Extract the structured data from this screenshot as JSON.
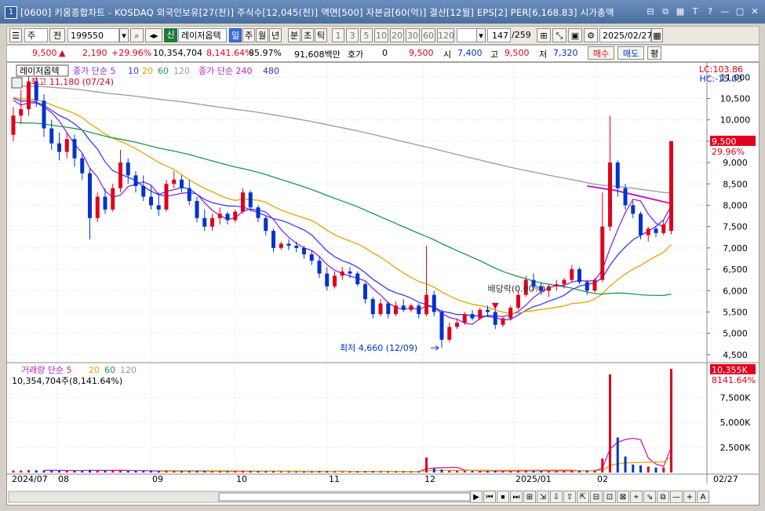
{
  "window": {
    "num": "1",
    "title": "[0600] 키움종합차트 - KOSDAQ 외국인보유[27(천)] 주식수[12,045(천)] 액면[500] 자본금[60(억)] 결산[12월] EPS[2] PER[6,168.83] 시가총액",
    "buttons": [
      "⊟",
      "⧉",
      "▦",
      "T",
      "?",
      "—",
      "□",
      "✕"
    ]
  },
  "toolbar": {
    "period_type": "주",
    "prefix": "전",
    "code": "199550",
    "sin": "신",
    "stock_name": "레이저옵텍",
    "periods": [
      "일",
      "주",
      "월",
      "년",
      "분",
      "초",
      "틱"
    ],
    "active_period": "일",
    "nums": [
      "1",
      "3",
      "5",
      "10",
      "20",
      "30",
      "60",
      "120"
    ],
    "count": "147",
    "total": "/259",
    "date": "2025/02/27"
  },
  "quote": {
    "price": "9,500",
    "arrow": "▲",
    "change": "2,190",
    "change_pct": "+29.96%",
    "volume": "10,354,704",
    "vol_ratio": "8,141.64%",
    "turnover": "85.97%",
    "amount": "91,608백만",
    "hoga_label": "호가",
    "hoga_val": "0",
    "ask": "9,500",
    "open_label": "시",
    "open": "7,400",
    "high_label": "고",
    "high": "9,500",
    "low_label": "저",
    "low": "7,320",
    "buy": "매수",
    "sell": "매도",
    "avg": "평"
  },
  "chart_data": {
    "type": "candlestick",
    "price_panel": {
      "stock": "레이저옵텍",
      "legend": [
        {
          "text": "종가 단순 5",
          "color": "#8a2be2"
        },
        {
          "text": "10",
          "color": "#3a3aff"
        },
        {
          "text": "20",
          "color": "#e6a400"
        },
        {
          "text": "60",
          "color": "#1a9a4a"
        },
        {
          "text": "120",
          "color": "#9a9a9a"
        },
        {
          "text": "종가 단순 240",
          "color": "#c020c0"
        },
        {
          "text": "480",
          "color": "#3030c0"
        }
      ],
      "lc": "LC:103.86",
      "hc": "HC:-15.03",
      "max_annot": "최고 11,180 (07/24)",
      "min_annot": "최저 4,660 (12/09)",
      "div_annot": "배당락(0.00%)",
      "last_price": "9,500",
      "last_pct": "29.96%",
      "y_ticks": [
        "11,000",
        "10,500",
        "10,000",
        "9,500",
        "9,000",
        "8,500",
        "8,000",
        "7,500",
        "7,000",
        "6,500",
        "6,000",
        "5,500",
        "5,000",
        "4,500"
      ],
      "ylim": [
        4350,
        11300
      ]
    },
    "volume_panel": {
      "legend": [
        {
          "text": "거래량 단순 5",
          "color": "#c020c0"
        },
        {
          "text": "20",
          "color": "#e6a400"
        },
        {
          "text": "60",
          "color": "#1a9a4a"
        },
        {
          "text": "120",
          "color": "#9a9a9a"
        }
      ],
      "info": "10,354,704주(8,141.64%)",
      "last_vol": "10,355K",
      "last_pct": "8141.64%",
      "y_ticks": [
        "7,500K",
        "5,000K",
        "2,500K"
      ],
      "ylim": [
        0,
        10500
      ]
    },
    "x_labels": [
      "2024/07",
      "08",
      "09",
      "10",
      "11",
      "12",
      "2025/01",
      "02",
      "02/27"
    ],
    "candles": [
      [
        9650,
        10300,
        9500,
        10100
      ],
      [
        10100,
        10700,
        9900,
        10250
      ],
      [
        10250,
        11180,
        10100,
        10900
      ],
      [
        10900,
        11000,
        10300,
        10450
      ],
      [
        10450,
        10600,
        9600,
        9800
      ],
      [
        9800,
        10000,
        9300,
        9450
      ],
      [
        9450,
        9700,
        9050,
        9250
      ],
      [
        9250,
        9700,
        9100,
        9550
      ],
      [
        9550,
        9650,
        8900,
        9100
      ],
      [
        9100,
        9200,
        8600,
        8750
      ],
      [
        8750,
        8850,
        7200,
        7700
      ],
      [
        7700,
        8300,
        7600,
        8200
      ],
      [
        8200,
        8400,
        7800,
        7900
      ],
      [
        7900,
        8500,
        7850,
        8400
      ],
      [
        8400,
        9300,
        8300,
        9000
      ],
      [
        9000,
        9100,
        8500,
        8700
      ],
      [
        8700,
        8800,
        8300,
        8450
      ],
      [
        8450,
        8700,
        8100,
        8200
      ],
      [
        8200,
        8450,
        7900,
        8000
      ],
      [
        8000,
        8300,
        7750,
        7900
      ],
      [
        7900,
        8600,
        7850,
        8500
      ],
      [
        8500,
        8800,
        8400,
        8600
      ],
      [
        8600,
        8700,
        8300,
        8400
      ],
      [
        8400,
        8600,
        8000,
        8100
      ],
      [
        8100,
        8200,
        7600,
        7700
      ],
      [
        7700,
        7900,
        7400,
        7500
      ],
      [
        7500,
        7800,
        7400,
        7700
      ],
      [
        7700,
        7950,
        7550,
        7800
      ],
      [
        7800,
        7850,
        7550,
        7650
      ],
      [
        7650,
        7900,
        7600,
        7850
      ],
      [
        7850,
        8400,
        7800,
        8300
      ],
      [
        8300,
        8350,
        7850,
        7950
      ],
      [
        7950,
        8000,
        7600,
        7700
      ],
      [
        7700,
        7750,
        7300,
        7400
      ],
      [
        7400,
        7450,
        6900,
        7000
      ],
      [
        7000,
        7150,
        6950,
        7100
      ],
      [
        7100,
        7200,
        6950,
        7050
      ],
      [
        7050,
        7150,
        6900,
        7000
      ],
      [
        7000,
        7050,
        6750,
        6850
      ],
      [
        6850,
        6950,
        6600,
        6700
      ],
      [
        6700,
        6800,
        6300,
        6400
      ],
      [
        6400,
        6550,
        6000,
        6100
      ],
      [
        6100,
        6450,
        6050,
        6350
      ],
      [
        6350,
        6550,
        6250,
        6450
      ],
      [
        6450,
        6550,
        6300,
        6400
      ],
      [
        6400,
        6450,
        6100,
        6150
      ],
      [
        6150,
        6200,
        5700,
        5800
      ],
      [
        5800,
        5850,
        5350,
        5450
      ],
      [
        5450,
        5800,
        5400,
        5700
      ],
      [
        5700,
        5750,
        5350,
        5450
      ],
      [
        5450,
        5750,
        5400,
        5650
      ],
      [
        5650,
        5800,
        5500,
        5550
      ],
      [
        5550,
        5700,
        5500,
        5650
      ],
      [
        5650,
        5700,
        5350,
        5450
      ],
      [
        5450,
        7050,
        5400,
        5900
      ],
      [
        5900,
        6000,
        5400,
        5500
      ],
      [
        5500,
        5550,
        4660,
        4850
      ],
      [
        4850,
        5250,
        4800,
        5150
      ],
      [
        5150,
        5350,
        5100,
        5250
      ],
      [
        5250,
        5500,
        5200,
        5450
      ],
      [
        5450,
        5550,
        5300,
        5350
      ],
      [
        5350,
        5600,
        5300,
        5550
      ],
      [
        5550,
        5650,
        5400,
        5500
      ],
      [
        5500,
        5550,
        5100,
        5200
      ],
      [
        5200,
        5400,
        5150,
        5350
      ],
      [
        5350,
        5650,
        5300,
        5600
      ],
      [
        5600,
        6000,
        5550,
        5900
      ],
      [
        5900,
        6350,
        5850,
        6250
      ],
      [
        6250,
        6400,
        6000,
        6100
      ],
      [
        6100,
        6200,
        5900,
        6000
      ],
      [
        6000,
        6150,
        5850,
        6100
      ],
      [
        6100,
        6250,
        6000,
        6150
      ],
      [
        6150,
        6300,
        6050,
        6250
      ],
      [
        6250,
        6600,
        6200,
        6500
      ],
      [
        6500,
        6550,
        6150,
        6200
      ],
      [
        6200,
        6250,
        5900,
        6000
      ],
      [
        6000,
        6300,
        5950,
        6250
      ],
      [
        6250,
        8300,
        6200,
        7500
      ],
      [
        7500,
        10100,
        7400,
        9000
      ],
      [
        9000,
        9050,
        8200,
        8400
      ],
      [
        8400,
        8500,
        7900,
        8000
      ],
      [
        8000,
        8100,
        7700,
        7800
      ],
      [
        7800,
        7850,
        7200,
        7300
      ],
      [
        7300,
        7500,
        7150,
        7450
      ],
      [
        7450,
        7500,
        7250,
        7350
      ],
      [
        7350,
        7650,
        7300,
        7550
      ],
      [
        7400,
        9500,
        7320,
        9500
      ]
    ],
    "volumes": [
      200,
      200,
      250,
      220,
      200,
      210,
      190,
      180,
      200,
      190,
      260,
      210,
      190,
      200,
      220,
      180,
      170,
      160,
      150,
      140,
      170,
      150,
      140,
      140,
      150,
      140,
      130,
      130,
      120,
      130,
      160,
      140,
      130,
      120,
      130,
      110,
      100,
      100,
      100,
      110,
      130,
      120,
      110,
      100,
      100,
      110,
      120,
      130,
      110,
      100,
      100,
      110,
      100,
      110,
      1500,
      400,
      300,
      200,
      180,
      170,
      160,
      150,
      160,
      170,
      150,
      160,
      180,
      200,
      170,
      160,
      150,
      160,
      170,
      200,
      180,
      170,
      210,
      1400,
      9800,
      3500,
      1600,
      800,
      700,
      600,
      500,
      500,
      10354
    ],
    "ma240": [
      [
        0,
        8450
      ],
      [
        10,
        8350
      ],
      [
        20,
        8200
      ],
      [
        30,
        8050
      ]
    ]
  },
  "colors": {
    "up": "#e0001b",
    "down": "#0033cc",
    "grid": "#dcdcdc"
  },
  "footer_icons": [
    "▶",
    "⏮",
    "⏹",
    "⏭",
    "⊞",
    "⇲",
    "⇩",
    "⇧",
    "⇱",
    "⊟",
    "⊡",
    "⊠",
    "⌖",
    "⇘",
    "⧉",
    "—",
    "+",
    "A"
  ]
}
